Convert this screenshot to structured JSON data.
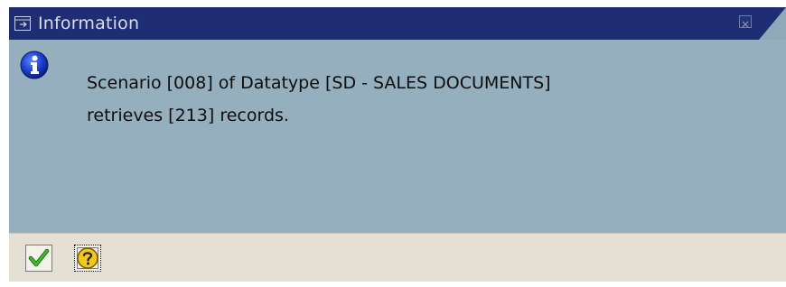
{
  "dialog": {
    "title": "Information",
    "message_line1": "Scenario [008] of Datatype [SD - SALES DOCUMENTS]",
    "message_line2": "retrieves [213] records."
  },
  "icons": {
    "title": "dialog-window-icon",
    "close": "close-icon",
    "info": "info-icon",
    "ok": "checkmark-icon",
    "help": "question-mark-icon"
  },
  "colors": {
    "titlebar": "#1f2d73",
    "content_bg": "#96afbf",
    "footer_bg": "#e4e1d4",
    "info_blue": "#1c3fd0",
    "check_green": "#2e9a1e",
    "help_yellow": "#f2c81a"
  }
}
